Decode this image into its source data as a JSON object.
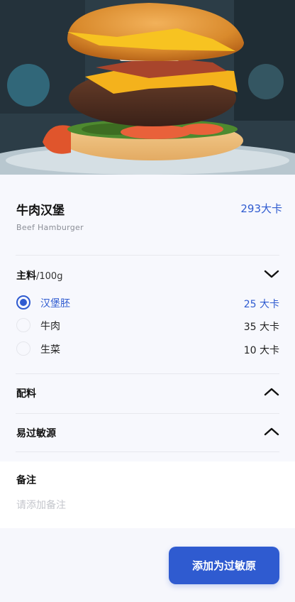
{
  "food": {
    "name": "牛肉汉堡",
    "name_en": "Beef  Hamburger",
    "calories": "293大卡"
  },
  "main_ingredients": {
    "title": "主料",
    "unit": "/100g",
    "expanded": true,
    "items": [
      {
        "name": "汉堡胚",
        "calories": "25 大卡",
        "selected": true
      },
      {
        "name": "牛肉",
        "calories": "35 大卡",
        "selected": false
      },
      {
        "name": "生菜",
        "calories": "10 大卡",
        "selected": false
      }
    ]
  },
  "side_ingredients": {
    "title": "配料",
    "expanded": false
  },
  "allergens": {
    "title": "易过敏源",
    "expanded": false
  },
  "notes": {
    "title": "备注",
    "placeholder": "请添加备注"
  },
  "action": {
    "label": "添加为过敏原"
  },
  "colors": {
    "accent": "#2f5bd0",
    "background": "#f7f8fd"
  }
}
